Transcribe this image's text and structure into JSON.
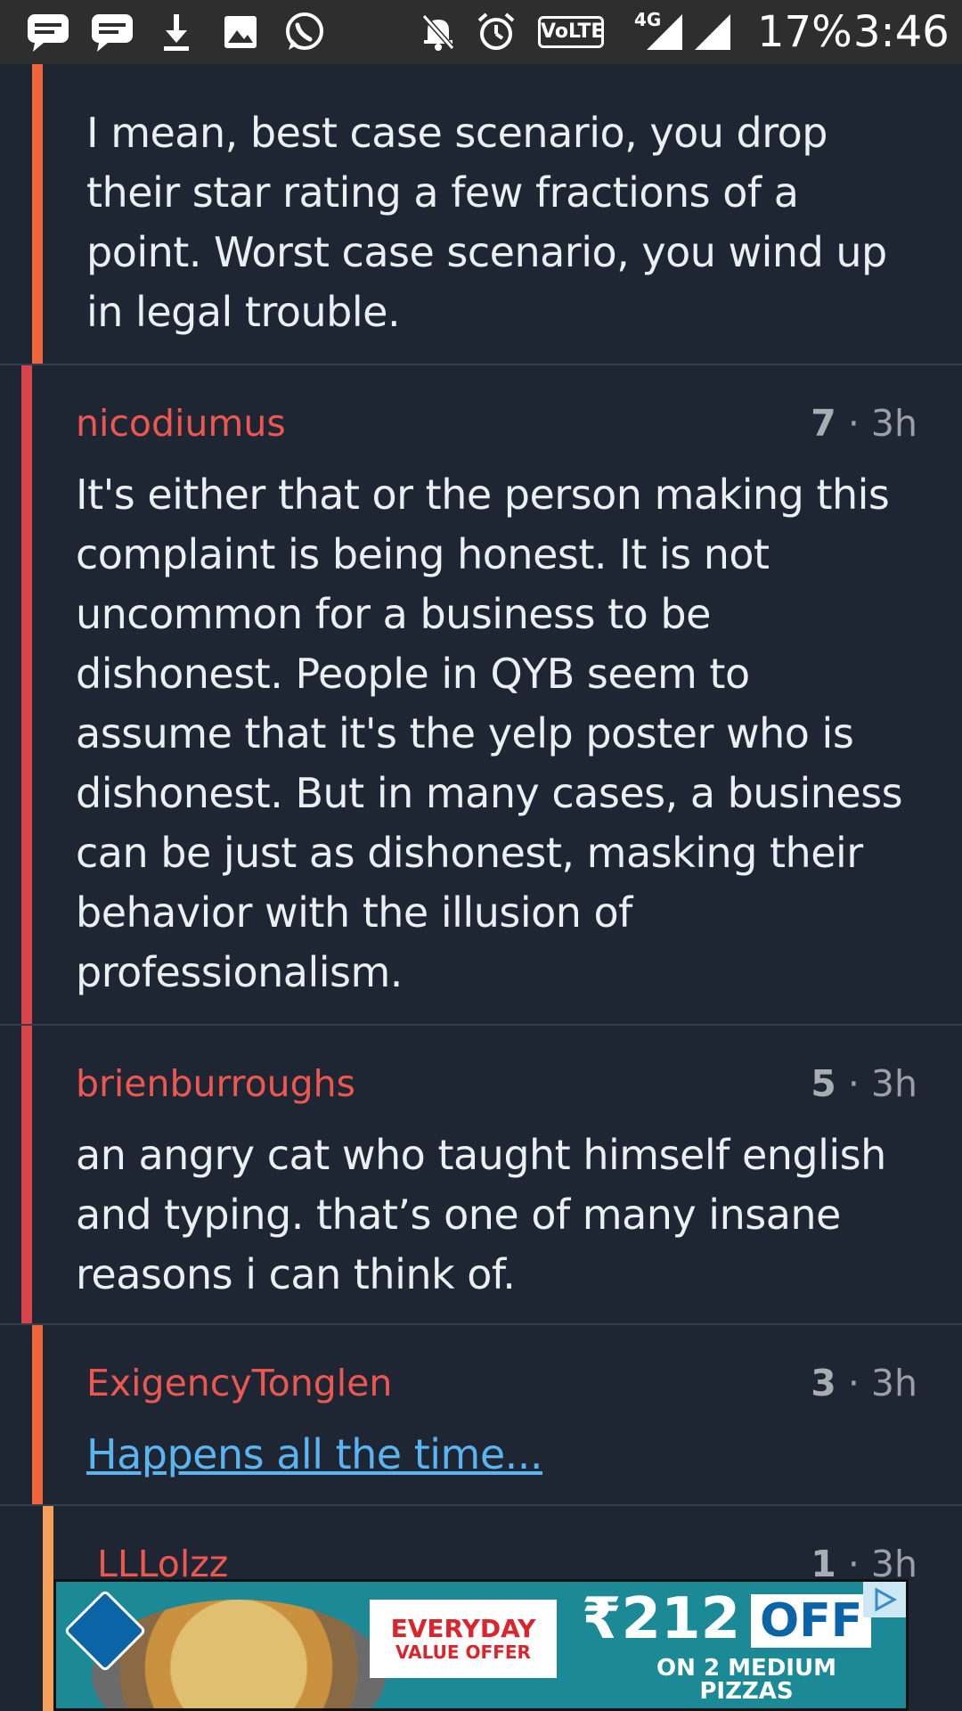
{
  "status_bar": {
    "battery": "17%",
    "time": "3:46",
    "volte_label": "VoLTE",
    "network": "4G",
    "icons": [
      "message-icon",
      "message-icon",
      "download-icon",
      "image-icon",
      "whatsapp-icon",
      "mute-icon",
      "alarm-icon",
      "signal-icon",
      "signal-icon"
    ]
  },
  "comments": [
    {
      "author": "",
      "score": "",
      "time": "",
      "body": "I mean, best case scenario, you drop\ntheir star rating a few fractions of a\npoint. Worst case scenario, you wind up\nin legal trouble.",
      "bar_color": "#f0643c"
    },
    {
      "author": "nicodiumus",
      "score": "7",
      "time": "· 3h",
      "body": "It's either that or the person making this\ncomplaint is being honest. It is not\nuncommon for a business to be\ndishonest. People in QYB seem to\nassume that it's the yelp poster who is\ndishonest. But in many cases, a business\ncan be just as dishonest, masking their\nbehavior with the illusion of\nprofessionalism.",
      "bar_color": "#d9434a"
    },
    {
      "author": "brienburroughs",
      "score": "5",
      "time": "· 3h",
      "body": "an angry cat who taught himself english\nand typing. that’s one of many insane\nreasons i can think of.",
      "bar_color": "#d9434a"
    },
    {
      "author": "ExigencyTonglen",
      "score": "3",
      "time": "· 3h",
      "body": "Happens all the time...",
      "bar_color": "#f0643c"
    },
    {
      "author": "LLLolzz",
      "score": "1",
      "time": "· 3h",
      "body": "",
      "bar_color": "#f5a05a"
    }
  ],
  "ad": {
    "headline_1": "EVERYDAY",
    "headline_2": "VALUE OFFER",
    "price": "₹212",
    "off": "OFF",
    "sub_1": "ON 2 MEDIUM",
    "sub_2": "PIZZAS"
  },
  "colors": {
    "background": "#1e2633",
    "author": "#ee5750",
    "link": "#5ab4f0"
  }
}
